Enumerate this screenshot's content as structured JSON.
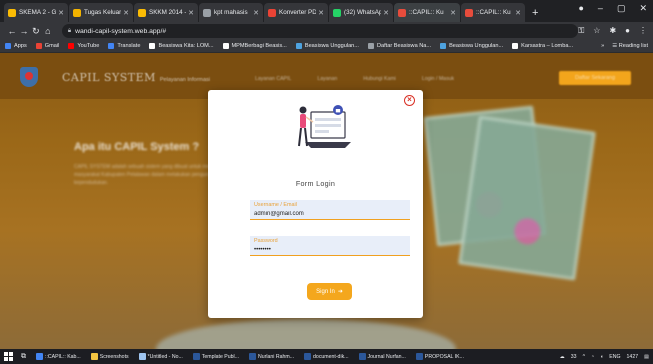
{
  "browser": {
    "tabs": [
      {
        "title": "SKEMA 2 - G",
        "color": "#fbbc04"
      },
      {
        "title": "Tugas Keluar",
        "color": "#f4b400"
      },
      {
        "title": "SKKM 2014 -",
        "color": "#fbbc04"
      },
      {
        "title": "kpt mahasis",
        "color": "#9aa0a6"
      },
      {
        "title": "Konverter PD",
        "color": "#ea4335"
      },
      {
        "title": "(32) WhatsAp",
        "color": "#25d366"
      },
      {
        "title": "::CAPIL:: Ku",
        "color": "#e74c3c",
        "active": true
      },
      {
        "title": "::CAPIL:: Ku",
        "color": "#e74c3c"
      }
    ],
    "new_tab_symbol": "+",
    "window_controls": [
      "●",
      "–",
      "▢",
      "✕"
    ],
    "url": "wandi-capil-system.web.app/#",
    "bookmarks": [
      {
        "label": "Apps",
        "color": "#4285f4"
      },
      {
        "label": "Gmail",
        "color": "#ea4335"
      },
      {
        "label": "YouTube",
        "color": "#ff0000"
      },
      {
        "label": "Translate",
        "color": "#4285f4"
      },
      {
        "label": "Beasiswa Kita: LOM...",
        "color": "#ffffff"
      },
      {
        "label": "MPMBerbagi Beasis...",
        "color": "#ffffff"
      },
      {
        "label": "Beasiswa Unggulan...",
        "color": "#4ea3e0"
      },
      {
        "label": "Daftar Beasiswa Na...",
        "color": "#9aa0a6"
      },
      {
        "label": "Beasiswa Unggulan...",
        "color": "#4ea3e0"
      },
      {
        "label": "Karsastra – Lomba...",
        "color": "#ffffff"
      }
    ],
    "bookmarks_more": "»",
    "reading_list": "Reading list"
  },
  "site": {
    "brand": "CAPIL SYSTEM",
    "brand_sub": "Pelayanan Informasi",
    "nav_links": [
      "Layanan CAPIL",
      "Layanan",
      "Hubungi Kami",
      "Login / Masuk"
    ],
    "nav_cta": "Daftar Sekarang",
    "hero_title": "Apa itu CAPIL System ?",
    "hero_text": "CAPIL SYSTEM adalah sebuah sistem yang dibuat untuk memudahkan masyarakat Kabupaten Pelalawan dalam melakukan pengurusan data kependudukan."
  },
  "login": {
    "title": "Form Login",
    "username_label": "Username / Email",
    "username_value": "admin@gmail.com",
    "password_label": "Password",
    "password_value": "password",
    "signin_label": "Sign In",
    "signin_icon": "➜",
    "close_symbol": "×"
  },
  "taskbar": {
    "items": [
      {
        "label": "::CAPIL:: Kab...",
        "color": "#4285f4"
      },
      {
        "label": "Screenshots",
        "color": "#f4c542"
      },
      {
        "label": "*Untitled - No...",
        "color": "#9ec5f0"
      },
      {
        "label": "Template Publ...",
        "color": "#2b579a"
      },
      {
        "label": "Nurlani Rahm...",
        "color": "#2b579a"
      },
      {
        "label": "document-dik...",
        "color": "#2b579a"
      },
      {
        "label": "Journal Nurfan...",
        "color": "#2b579a"
      },
      {
        "label": "PROPOSAL IK...",
        "color": "#2b579a"
      }
    ],
    "weather": "33",
    "lang": "ENG",
    "time": "1427"
  }
}
